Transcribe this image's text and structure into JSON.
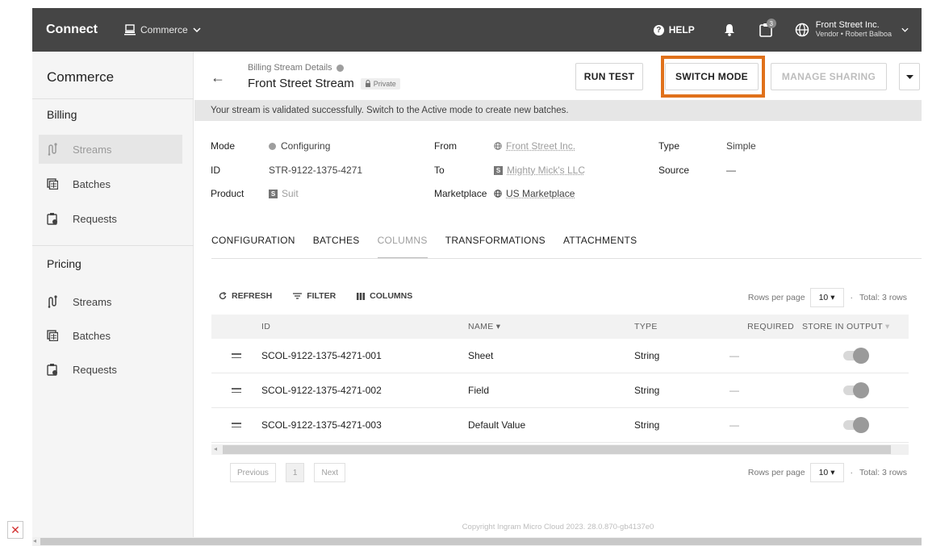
{
  "topbar": {
    "brand": "Connect",
    "module": "Commerce",
    "help": "HELP",
    "notification_count": "3",
    "account_name": "Front Street Inc.",
    "account_sub": "Vendor • Robert Balboa"
  },
  "sidebar": {
    "title": "Commerce",
    "billing": {
      "heading": "Billing",
      "items": [
        {
          "label": "Streams",
          "icon": "streams-icon",
          "active": true
        },
        {
          "label": "Batches",
          "icon": "batches-icon"
        },
        {
          "label": "Requests",
          "icon": "requests-icon"
        }
      ]
    },
    "pricing": {
      "heading": "Pricing",
      "items": [
        {
          "label": "Streams",
          "icon": "streams-icon"
        },
        {
          "label": "Batches",
          "icon": "batches-icon"
        },
        {
          "label": "Requests",
          "icon": "requests-icon"
        }
      ]
    }
  },
  "header": {
    "breadcrumb": "Billing Stream Details",
    "title": "Front Street Stream",
    "badge": "Private",
    "run_test": "RUN TEST",
    "switch_mode": "SWITCH MODE",
    "manage_sharing": "MANAGE SHARING"
  },
  "alert": "Your stream is validated successfully. Switch to the Active mode to create new batches.",
  "details": {
    "mode_label": "Mode",
    "mode_value": "Configuring",
    "id_label": "ID",
    "id_value": "STR-9122-1375-4271",
    "product_label": "Product",
    "product_value": "Suit",
    "from_label": "From",
    "from_value": "Front Street Inc.",
    "to_label": "To",
    "to_value": "Mighty Mick's LLC",
    "marketplace_label": "Marketplace",
    "marketplace_value": "US Marketplace",
    "type_label": "Type",
    "type_value": "Simple",
    "source_label": "Source",
    "source_value": "—"
  },
  "tabs": [
    "CONFIGURATION",
    "BATCHES",
    "COLUMNS",
    "TRANSFORMATIONS",
    "ATTACHMENTS"
  ],
  "active_tab": "COLUMNS",
  "toolbar": {
    "refresh": "REFRESH",
    "filter": "FILTER",
    "columns": "COLUMNS",
    "rows_per_page_label": "Rows per page",
    "rows_per_page_value": "10",
    "total": "Total: 3 rows"
  },
  "table": {
    "headers": [
      "ID",
      "NAME",
      "TYPE",
      "REQUIRED",
      "STORE IN OUTPUT"
    ],
    "rows": [
      {
        "id": "SCOL-9122-1375-4271-001",
        "name": "Sheet",
        "type": "String",
        "required": "—",
        "store": true
      },
      {
        "id": "SCOL-9122-1375-4271-002",
        "name": "Field",
        "type": "String",
        "required": "—",
        "store": true
      },
      {
        "id": "SCOL-9122-1375-4271-003",
        "name": "Default Value",
        "type": "String",
        "required": "—",
        "store": true
      }
    ]
  },
  "pager": {
    "previous": "Previous",
    "page": "1",
    "next": "Next"
  },
  "footer": "Copyright Ingram Micro Cloud 2023. 28.0.870-gb4137e0",
  "colors": {
    "topbar": "#454545",
    "highlight": "#e0711b",
    "sidebar": "#f5f5f5"
  }
}
